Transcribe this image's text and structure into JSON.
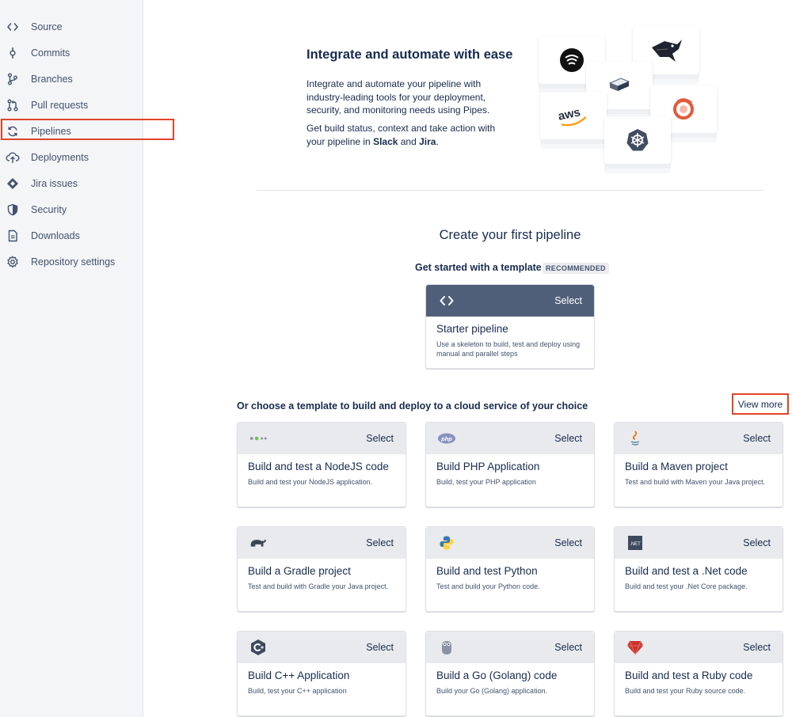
{
  "sidebar": {
    "items": [
      {
        "label": "Source",
        "icon": "code-icon"
      },
      {
        "label": "Commits",
        "icon": "commit-icon"
      },
      {
        "label": "Branches",
        "icon": "branch-icon"
      },
      {
        "label": "Pull requests",
        "icon": "pull-request-icon"
      },
      {
        "label": "Pipelines",
        "icon": "pipelines-icon",
        "active": true
      },
      {
        "label": "Deployments",
        "icon": "cloud-upload-icon"
      },
      {
        "label": "Jira issues",
        "icon": "jira-icon"
      },
      {
        "label": "Security",
        "icon": "shield-icon"
      },
      {
        "label": "Downloads",
        "icon": "document-icon"
      },
      {
        "label": "Repository settings",
        "icon": "gear-icon"
      }
    ]
  },
  "hero": {
    "title": "Integrate and automate with ease",
    "paragraph1": "Integrate and automate your pipeline with industry-leading tools for your deployment, security, and monitoring needs using Pipes.",
    "paragraph2_prefix": "Get build status, context and take action with your pipeline in ",
    "slack": "Slack",
    "and": " and ",
    "jira": "Jira",
    "period": ".",
    "aws_logo_text": "aws",
    "integrations": [
      "wifi-logo-icon",
      "server-logo-icon",
      "aws-logo-icon",
      "kubernetes-icon",
      "bitbucket-bird-icon",
      "monitor-logo-icon"
    ]
  },
  "create": {
    "title": "Create your first pipeline",
    "get_started": "Get started with a template",
    "recommended": "RECOMMENDED",
    "starter": {
      "select": "Select",
      "title": "Starter pipeline",
      "description": "Use a skeleton to build, test and deploy using manual and parallel steps"
    },
    "or_choose": "Or choose a template to build and deploy to a cloud service of your choice",
    "view_more": "View more",
    "templates": [
      {
        "title": "Build and test a NodeJS code",
        "description": "Build and test your NodeJS application.",
        "icon": "nodejs-icon",
        "select": "Select"
      },
      {
        "title": "Build PHP Application",
        "description": "Build, test your PHP application",
        "icon": "php-icon",
        "select": "Select",
        "icon_text": "php"
      },
      {
        "title": "Build a Maven project",
        "description": "Test and build with Maven your Java project.",
        "icon": "java-icon",
        "select": "Select"
      },
      {
        "title": "Build a Gradle project",
        "description": "Test and build with Gradle your Java project.",
        "icon": "gradle-elephant-icon",
        "select": "Select"
      },
      {
        "title": "Build and test Python",
        "description": "Test and build your Python code.",
        "icon": "python-icon",
        "select": "Select"
      },
      {
        "title": "Build and test a .Net code",
        "description": "Build and test your .Net Core package.",
        "icon": "dotnet-icon",
        "select": "Select",
        "icon_text": ".NET"
      },
      {
        "title": "Build C++ Application",
        "description": "Build, test your C++ application",
        "icon": "cpp-icon",
        "select": "Select"
      },
      {
        "title": "Build a Go (Golang) code",
        "description": "Build your Go (Golang) application.",
        "icon": "golang-gopher-icon",
        "select": "Select"
      },
      {
        "title": "Build and test a Ruby code",
        "description": "Build and test your Ruby source code.",
        "icon": "ruby-icon",
        "select": "Select"
      }
    ]
  },
  "colors": {
    "highlight": "#e0442a",
    "starter_header": "#505f79",
    "card_header": "#e9eaee",
    "text": "#172b4d"
  }
}
